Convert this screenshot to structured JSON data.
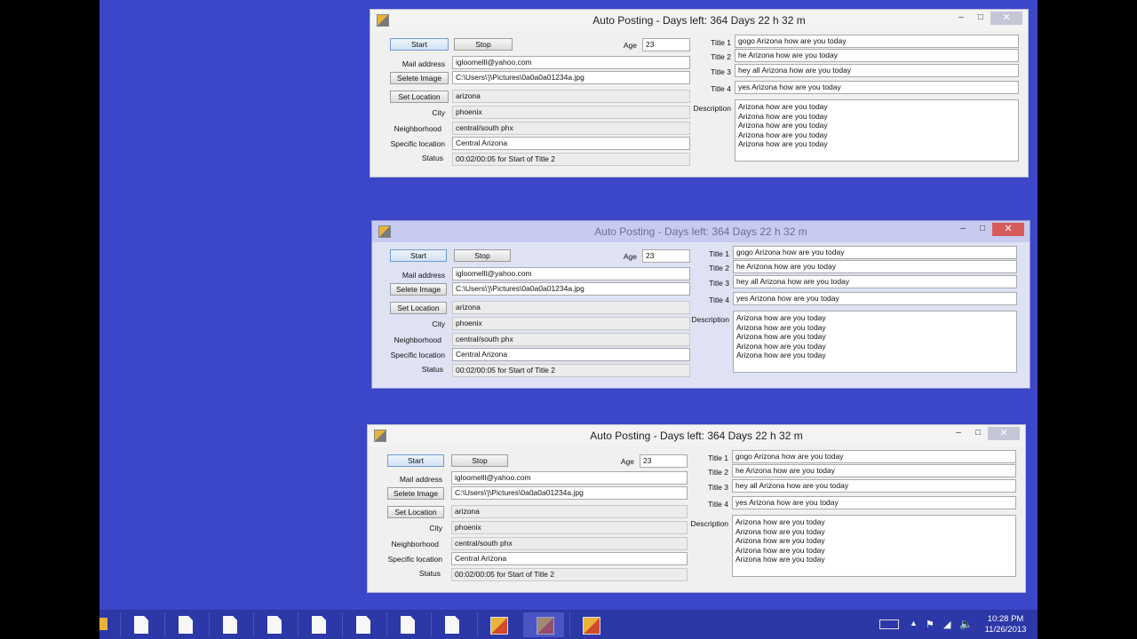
{
  "window": {
    "title": "Auto Posting - Days left: 364 Days 22 h 32 m",
    "start_label": "Start",
    "stop_label": "Stop",
    "age_label": "Age",
    "age_value": "23",
    "mail_label": "Mail address",
    "mail_value": "igloomelll@yahoo.com",
    "image_button": "Selete Image",
    "image_path": "C:\\Users\\'j\\Pictures\\0a0a0a01234a.jpg",
    "location_button": "Set Location",
    "location_value": "arizona",
    "city_label": "City",
    "city_value": "phoenix",
    "neighborhood_label": "Neighborhood",
    "neighborhood_value": "central/south phx",
    "specific_label": "Specific location",
    "specific_value": "Central Arizona",
    "status_label": "Status",
    "status_value": "00:02/00:05  for Start  of Title 2",
    "title_fields": [
      {
        "label": "Title 1",
        "value": "gogo Arizona how are you today"
      },
      {
        "label": "Title 2",
        "value": "he Arizona how are you today"
      },
      {
        "label": "Title 3",
        "value": "hey all Arizona how are you today"
      },
      {
        "label": "Title 4",
        "value": "yes Arizona how are you today"
      }
    ],
    "description_label": "Description",
    "description_lines": [
      "Arizona how are you today",
      "Arizona how are you today",
      "Arizona how are you today",
      "Arizona how are you today",
      "Arizona how are you today"
    ],
    "minimize_glyph": "–",
    "maximize_glyph": "□",
    "close_glyph": "✕"
  },
  "taskbar": {
    "time": "10:28 PM",
    "date": "11/26/2013",
    "file_items": 8,
    "app_items": 3
  },
  "colors": {
    "desktop": "#3b46c9",
    "taskbar": "#2c37a8",
    "inactive_close": "#d75b5b"
  }
}
